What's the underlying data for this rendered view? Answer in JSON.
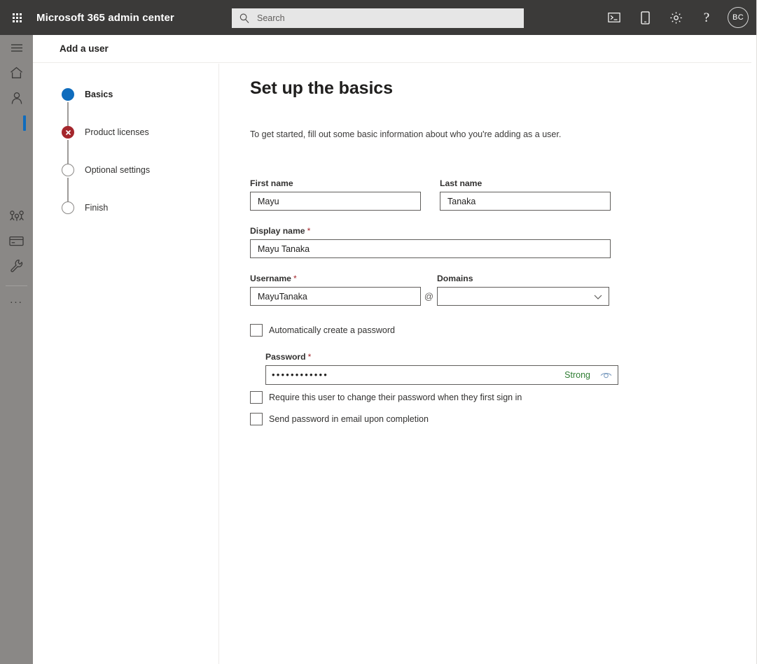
{
  "colors": {
    "suitebar_bg": "#3b3a39",
    "rail_bg": "#8a8886",
    "accent_blue": "#0f6cbd",
    "error_red": "#a4262c",
    "strong_green": "#2e7d32",
    "required_red": "#a4262c"
  },
  "suitebar": {
    "waffle_name": "app-launcher",
    "title": "Microsoft 365 admin center",
    "search": {
      "placeholder": "Search",
      "value": "",
      "icon": "search-icon"
    },
    "actions": [
      {
        "name": "console-icon",
        "label": ""
      },
      {
        "name": "mobile-device-icon",
        "label": ""
      },
      {
        "name": "gear-icon",
        "label": ""
      },
      {
        "name": "help-icon",
        "label": "?"
      }
    ],
    "avatar": {
      "initials": "BC"
    }
  },
  "rail": {
    "items": [
      {
        "name": "hamburger-menu-icon",
        "icon": "hamburger",
        "selected": false
      },
      {
        "name": "home-icon",
        "icon": "home",
        "selected": false
      },
      {
        "name": "users-icon",
        "icon": "person",
        "selected": false
      },
      {
        "name": "active-section-indicator",
        "icon": "selection",
        "selected": true
      },
      {
        "name": "teams-groups-icon",
        "icon": "teams",
        "selected": false
      },
      {
        "name": "billing-icon",
        "icon": "card",
        "selected": false
      },
      {
        "name": "setup-icon",
        "icon": "wrench",
        "selected": false
      }
    ],
    "show_all_label": "..."
  },
  "page_header": {
    "title": "Add a user"
  },
  "wizard": {
    "steps": [
      {
        "label": "Basics",
        "state": "current"
      },
      {
        "label": "Product licenses",
        "state": "error"
      },
      {
        "label": "Optional settings",
        "state": "todo"
      },
      {
        "label": "Finish",
        "state": "todo"
      }
    ]
  },
  "main": {
    "title": "Set up the basics",
    "subtitle": "To get started, fill out some basic information about who you're adding as a user.",
    "fields": {
      "first_name": {
        "label": "First name",
        "required": false,
        "value": "Mayu",
        "placeholder": ""
      },
      "last_name": {
        "label": "Last name",
        "required": false,
        "value": "Tanaka",
        "placeholder": ""
      },
      "display_name": {
        "label": "Display name",
        "required": true,
        "required_mark": "*",
        "value": "Mayu Tanaka",
        "placeholder": ""
      },
      "username": {
        "label": "Username",
        "required": true,
        "required_mark": "*",
        "value": "MayuTanaka",
        "placeholder": ""
      },
      "at_separator": "@",
      "domains": {
        "label": "Domains",
        "selected": "",
        "placeholder": ""
      },
      "password": {
        "label": "Password",
        "required_mark": "*",
        "masked_value": "••••••••••••",
        "strength": "Strong"
      }
    },
    "checkboxes": [
      {
        "name": "auto-create-password-checkbox",
        "label": "Automatically create a password",
        "checked": false
      },
      {
        "name": "require-password-change-checkbox",
        "label": "Require this user to change their password when they first sign in",
        "checked": false
      },
      {
        "name": "send-password-email-checkbox",
        "label": "Send password in email upon completion",
        "checked": false
      }
    ]
  }
}
